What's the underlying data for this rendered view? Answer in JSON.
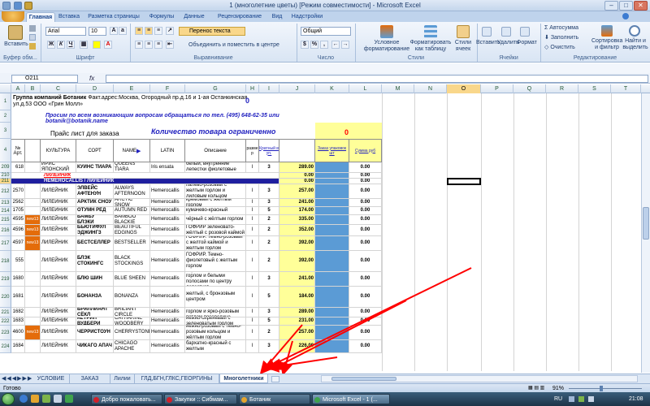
{
  "window": {
    "title": "1 (многолетние цветы)  [Режим совместимости] - Microsoft Excel"
  },
  "ribbon_tabs": [
    "Главная",
    "Вставка",
    "Разметка страницы",
    "Формулы",
    "Данные",
    "Рецензирование",
    "Вид",
    "Надстройки"
  ],
  "ribbon": {
    "paste_label": "Вставить",
    "font_name": "Arial",
    "font_size": "10",
    "wrap_text": "Перенос текста",
    "merge_center": "Объединить и поместить в центре",
    "number_format": "Общий",
    "conditional_format": "Условное форматирование",
    "format_as_table": "Форматировать как таблицу",
    "cell_styles": "Стили ячеек",
    "insert": "Вставить",
    "delete": "Удалить",
    "format": "Формат",
    "autosum": "Автосумма",
    "fill": "Заполнить",
    "clear": "Очистить",
    "sort_filter": "Сортировка и фильтр",
    "find_select": "Найти и выделить",
    "groups": [
      "Буфер обм...",
      "Шрифт",
      "Выравнивание",
      "Число",
      "Стили",
      "Ячейки",
      "Редактирование"
    ]
  },
  "formula_bar": {
    "name_box": "O211",
    "formula": ""
  },
  "columns": [
    "A",
    "B",
    "C",
    "D",
    "E",
    "F",
    "G",
    "H",
    "I",
    "J",
    "K",
    "L",
    "M",
    "N",
    "O",
    "P",
    "Q",
    "R",
    "S",
    "T"
  ],
  "header_block": {
    "company": "Группа компаний Ботаник",
    "address": "Факт.адрес:Москва, Огородный пр.д.16 и 1-ая Останкинская ул.д.53 ООО «Грин Молл»",
    "zero_top": "0",
    "questions": "Просим по всем возникающим вопросам обращаться по тел. (495) 648-62-35  или botanik@botanik.name",
    "price_list": "Прайс лист для заказа",
    "limited": "Количество товара ограниченно",
    "zero_right": "0"
  },
  "table_header": {
    "num": "№ Арт.",
    "culture": "КУЛЬТУРА",
    "sort": "СОРТ",
    "name": "NAME",
    "latin": "LATIN",
    "desc": "Описание",
    "size": "разме р",
    "multiplicity": "Кратный в уп.",
    "order": "Заказ упаковок шт",
    "sum": "Сумма руб"
  },
  "rows": [
    {
      "row": "209",
      "art": "618",
      "culture": "ИРИС ЯПОНСКИЙ",
      "sort": "КУИНС ТИАРА",
      "name": "QUEENS TIARA",
      "latin": "Iris ensata",
      "desc": "белый, внутренние лепестки фиолетовые",
      "size": "I",
      "mult": "3",
      "price": "289.00",
      "sum": "0.00"
    },
    {
      "row": "210",
      "group": "ЛИЛЕЙНИК",
      "price": "0.00",
      "sum": "0.00"
    },
    {
      "row": "211",
      "group": "HEMEROCALLIS / ЛИЛЕЙНИК",
      "price": "0.00",
      "sum": "0.00"
    },
    {
      "row": "212",
      "art": "2570",
      "culture": "ЛИЛЕЙНИК",
      "sort": "ЭЛВЕЙС АФТЕНУН",
      "name": "ALWAYS AFTERNOON",
      "latin": "Hemerocallis",
      "desc": "палево-розовый с желтым горлом и лиловым кольцом",
      "size": "I",
      "mult": "3",
      "price": "257.00",
      "sum": "0.00"
    },
    {
      "row": "213",
      "art": "2562",
      "culture": "ЛИЛЕЙНИК",
      "sort": "АРКТИК СНОУ",
      "name": "ARCTIC SNOW",
      "latin": "Hemerocallis",
      "desc": "кремовый с желтым горлом",
      "size": "I",
      "mult": "3",
      "price": "241.00",
      "sum": "0.00"
    },
    {
      "row": "214",
      "art": "1705",
      "culture": "ЛИЛЕЙНИК",
      "sort": "ОТУМН РЕД",
      "name": "AUTUMN RED",
      "latin": "Hemerocallis",
      "desc": "кумачево-красный",
      "size": "I",
      "mult": "5",
      "price": "174.00",
      "sum": "0.00"
    },
    {
      "row": "215",
      "art": "4595",
      "new": "new13",
      "culture": "ЛИЛЕЙНИК",
      "sort": "БАМБУ БЛЭКИ",
      "name": "BAMBOO BLACKIE",
      "latin": "Hemerocallis",
      "desc": "чёрный с жёлтым горлом",
      "size": "I",
      "mult": "2",
      "price": "335.00",
      "sum": "0.00"
    },
    {
      "row": "216",
      "art": "4596",
      "new": "new13",
      "culture": "ЛИЛЕЙНИК",
      "sort": "БЬЮТИФУЛ ЭДЖИНГЗ",
      "name": "BEAUTIFUL EDGINGS",
      "latin": "Hemerocallis",
      "desc": "ГОФРИР зеленовато-жёлтый с розовой каймой",
      "size": "I",
      "mult": "2",
      "price": "352.00",
      "sum": "0.00"
    },
    {
      "row": "217",
      "art": "4597",
      "new": "new13",
      "culture": "ЛИЛЕЙНИК",
      "sort": "БЕСТСЕЛЛЕР",
      "name": "BESTSELLER",
      "latin": "Hemerocallis",
      "desc": "ГОФРИР. Темно-розовый с желтой каймой и желтым горлом",
      "size": "I",
      "mult": "2",
      "price": "392.00",
      "sum": "0.00"
    },
    {
      "row": "218",
      "art": "555",
      "culture": "ЛИЛЕЙНИК",
      "sort": "БЛЭК СТОКИНГС",
      "name": "BLACK STOCKINGS",
      "latin": "Hemerocallis",
      "desc": "ГОФРИР. Темно-фиолетовый с желтым горлом",
      "size": "I",
      "mult": "2",
      "price": "392.00",
      "sum": "0.00"
    },
    {
      "row": "219",
      "art": "1680",
      "culture": "ЛИЛЕЙНИК",
      "sort": "БЛЮ ШИН",
      "name": "BLUE SHEEN",
      "latin": "Hemerocallis",
      "desc": "сиреневый с желтым горлом и белыми полосами по центру лепестков",
      "size": "I",
      "mult": "3",
      "price": "241.00",
      "sum": "0.00"
    },
    {
      "row": "220",
      "art": "1681",
      "culture": "ЛИЛЕЙНИК",
      "sort": "БОНАНЗА",
      "name": "BONANZA",
      "latin": "Hemerocallis",
      "desc": "желтый, с бронзовым центром",
      "size": "I",
      "mult": "5",
      "price": "184.00",
      "sum": "0.00"
    },
    {
      "row": "221",
      "art": "1682",
      "culture": "ЛИЛЕЙНИК",
      "sort": "БРИЛЛИАНТ СЁКЛ",
      "name": "BRILIANT CIRCLE",
      "latin": "Hemerocallis",
      "desc": "нисто-белый с желтым горлом и ярко-розовым петлом посередине",
      "size": "I",
      "mult": "3",
      "price": "289.00",
      "sum": "0.00"
    },
    {
      "row": "222",
      "art": "1683",
      "culture": "ЛИЛЕЙНИК",
      "sort": "КЕТРИН ВУДБЕРИ",
      "name": "CATHARINE WOODBERY",
      "latin": "Hemerocallis",
      "desc": "нежно-сиреневый с зеленоватым горлом",
      "size": "I",
      "mult": "5",
      "price": "231.00",
      "sum": "0.00"
    },
    {
      "row": "223",
      "art": "4600",
      "new": "new13",
      "culture": "ЛИЛЕЙНИК",
      "sort": "ЧЕРРИСТОУН",
      "name": "CHERRYSTONE",
      "latin": "Hemerocallis",
      "desc": "нежно-розовый с тёмно-розовым кольцом и жёлтым горлом",
      "size": "I",
      "mult": "2",
      "price": "257.00",
      "sum": "0.00"
    },
    {
      "row": "224",
      "art": "1684",
      "culture": "ЛИЛЕЙНИК",
      "sort": "ЧИКАГО АПАЧ",
      "name": "CHICAGO APACHE",
      "latin": "Hemerocallis",
      "desc": "бархатно-красный с желтым",
      "size": "I",
      "mult": "3",
      "price": "226.00",
      "sum": "0.00"
    }
  ],
  "sheet_tabs": [
    "УСЛОВИЕ",
    "ЗАКАЗ ФОРМА",
    "Лилии",
    "ГЛД,БГН,ГЛКС,ГЕОРГИНЫ",
    "Многолетники"
  ],
  "active_sheet": "Многолетники",
  "status": {
    "ready": "Готово",
    "zoom": "91%"
  },
  "taskbar": {
    "items": [
      "Добро пожаловать...",
      "Закупки :: Сибмам...",
      "Ботаник",
      "Microsoft Excel - 1 (..."
    ],
    "lang": "RU",
    "time": "21:08"
  },
  "colors": {
    "accent": "#15428b",
    "yellow": "#ffff99",
    "blue": "#5b9bd5",
    "header_blue": "#1f1fbf",
    "red": "#ff0000",
    "orange": "#e46c0a",
    "selection_header": "#f9d78b"
  }
}
